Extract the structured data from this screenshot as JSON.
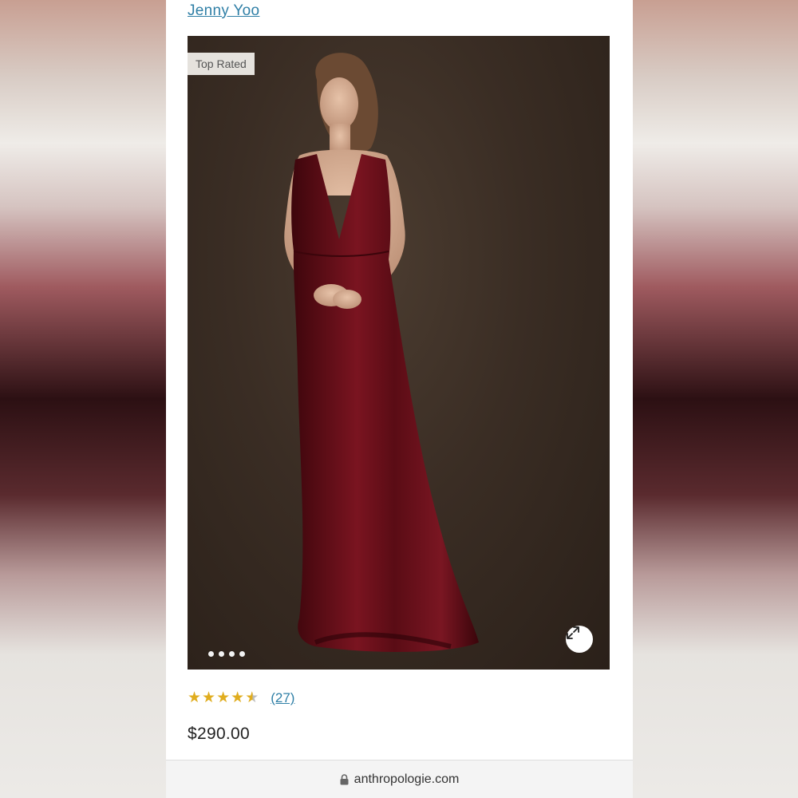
{
  "product": {
    "brand": "Jenny Yoo",
    "badge": "Top Rated",
    "rating_value": 4.5,
    "rating_max": 5,
    "review_count": "(27)",
    "price": "$290.00"
  },
  "gallery": {
    "image_count": 4,
    "current_index": 1,
    "image_description_icon": "dress-photo"
  },
  "browser": {
    "url": "anthropologie.com"
  },
  "colors": {
    "link": "#2f7fa6",
    "star": "#e0ad1f",
    "dress": "#6b0f18"
  }
}
